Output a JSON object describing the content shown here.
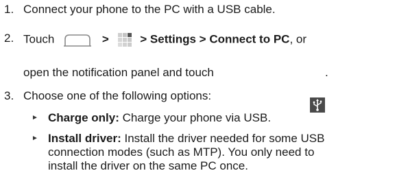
{
  "steps": [
    {
      "number": "1.",
      "text": "Connect your phone to the PC with a USB cable."
    },
    {
      "number": "2.",
      "prefix": "Touch",
      "sep1": ">",
      "settings_path": "> Settings > Connect to PC",
      "suffix": ", or",
      "continuation": "open the notification panel and touch",
      "continuation_end": "."
    },
    {
      "number": "3.",
      "text": "Choose one of the following options:"
    }
  ],
  "options": [
    {
      "label": "Charge only:",
      "text": "Charge your phone via USB."
    },
    {
      "label": "Install driver:",
      "text_lines": [
        "Install the driver needed for some USB",
        "connection modes (such as MTP). You only need to",
        "install the driver on the same PC once."
      ]
    }
  ],
  "bullet_glyph": "►",
  "icons": {
    "home": "home-outline-icon",
    "apps": "apps-grid-icon",
    "usb": "usb-icon"
  }
}
